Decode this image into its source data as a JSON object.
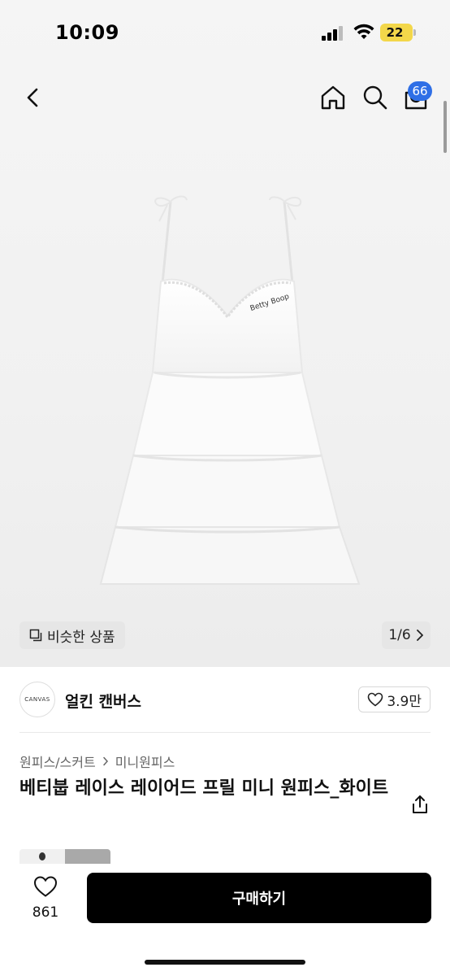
{
  "status_bar": {
    "time": "10:09",
    "battery": "22",
    "battery_color": "#f3d74a"
  },
  "nav": {
    "icons": [
      "back-chevron-icon",
      "home-icon",
      "search-icon",
      "shopping-bag-icon"
    ],
    "cart_badge": "66",
    "badge_color": "#2f6fe6"
  },
  "image": {
    "similar_label": "비슷한 상품",
    "page_indicator": "1/6",
    "logo_text": "Betty Boop"
  },
  "brand": {
    "logo_text": "CANVAS",
    "name": "얼킨 캔버스",
    "likes": "3.9만"
  },
  "breadcrumb": {
    "category": "원피스/스커트",
    "subcategory": "미니원피스"
  },
  "product": {
    "title": "베티붑 레이스 레이어드 프릴 미니 원피스_화이트"
  },
  "bottom_bar": {
    "like_count": "861",
    "buy_label": "구매하기"
  }
}
